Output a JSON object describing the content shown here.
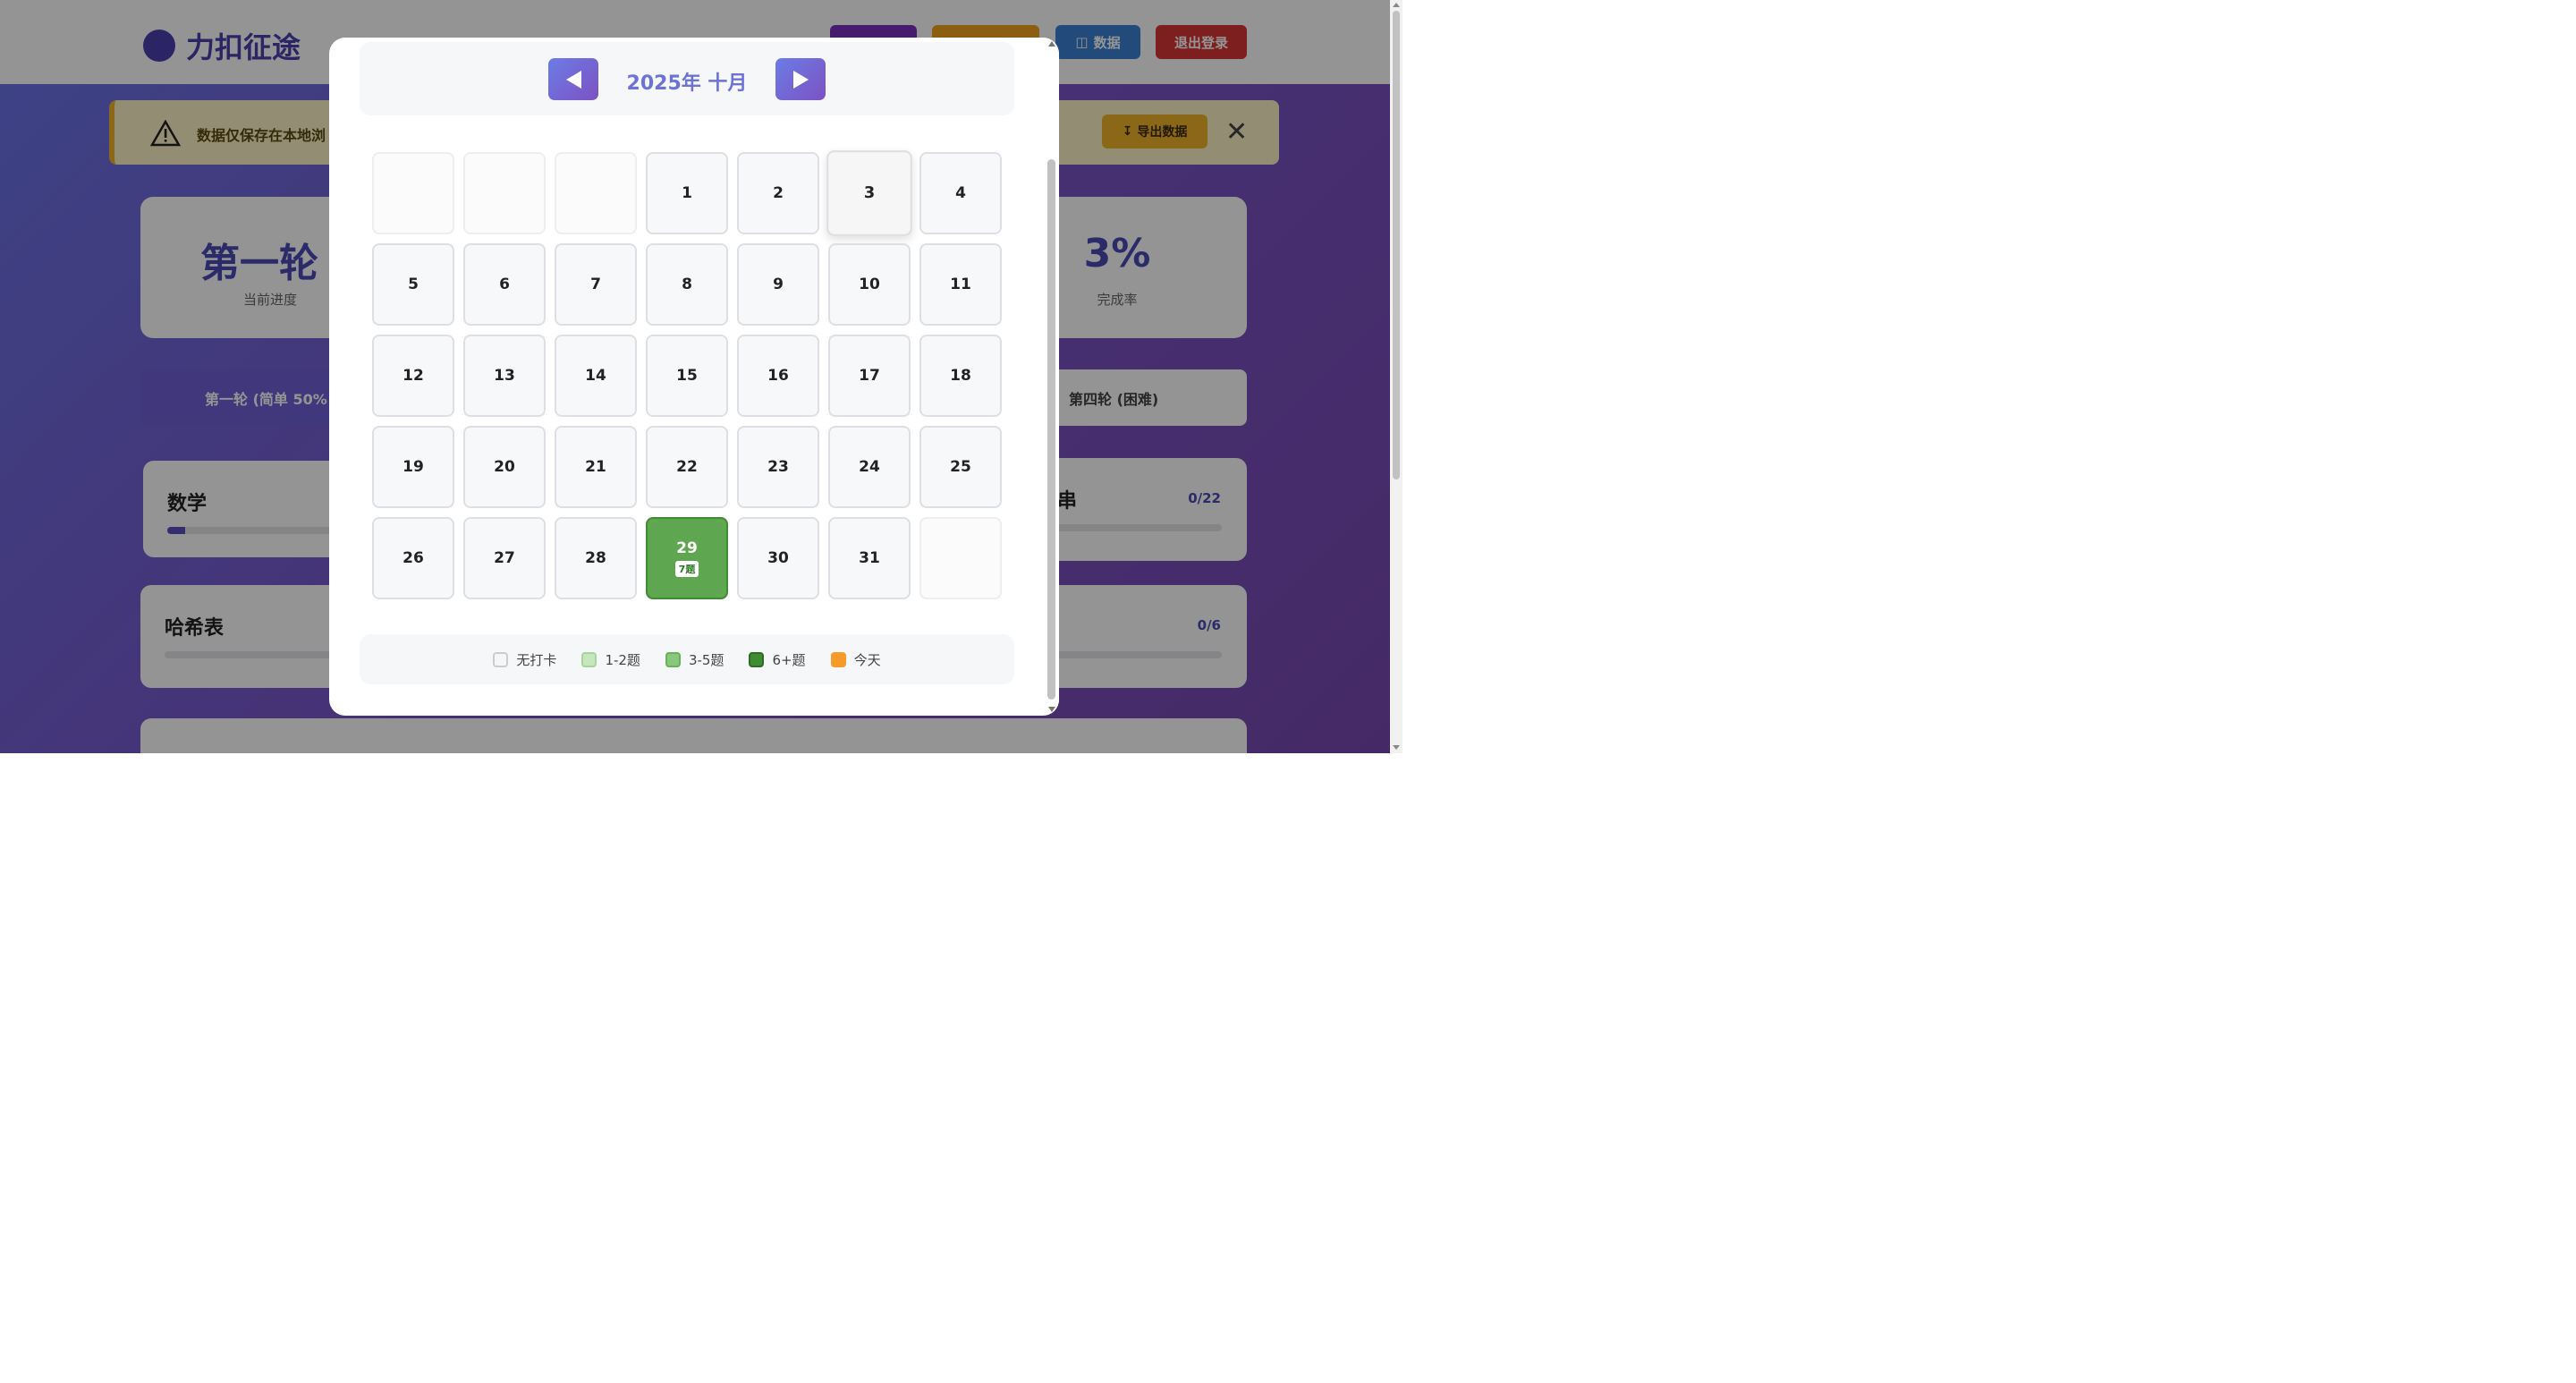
{
  "header": {
    "brand_title": "力扣征途",
    "buttons": [
      "",
      "",
      "数据",
      "退出登录"
    ]
  },
  "warning": {
    "text": "数据仅保存在本地浏",
    "export_label": "导出数据",
    "close_glyph": "✕"
  },
  "stats": [
    {
      "value": "第一轮",
      "label": "当前进度"
    },
    {
      "value": "3%",
      "label": "完成率"
    }
  ],
  "rounds": [
    "第一轮 (简单 50%",
    "第四轮 (困难)"
  ],
  "topics": [
    {
      "title": "数学",
      "count": "",
      "progress": 0.1
    },
    {
      "title": "串",
      "count": "0/22",
      "progress": 0
    },
    {
      "title": "哈希表",
      "count": "",
      "progress": 0
    },
    {
      "title": "",
      "count": "0/6",
      "progress": 0
    }
  ],
  "calendar": {
    "month_label": "2025年 十月",
    "days": [
      {
        "num": "",
        "badge": "",
        "level": "empty"
      },
      {
        "num": "",
        "badge": "",
        "level": "empty"
      },
      {
        "num": "",
        "badge": "",
        "level": "empty"
      },
      {
        "num": "1",
        "badge": "",
        "level": "none"
      },
      {
        "num": "2",
        "badge": "",
        "level": "none"
      },
      {
        "num": "3",
        "badge": "",
        "level": "hover"
      },
      {
        "num": "4",
        "badge": "",
        "level": "none"
      },
      {
        "num": "5",
        "badge": "",
        "level": "none"
      },
      {
        "num": "6",
        "badge": "",
        "level": "none"
      },
      {
        "num": "7",
        "badge": "",
        "level": "none"
      },
      {
        "num": "8",
        "badge": "",
        "level": "none"
      },
      {
        "num": "9",
        "badge": "",
        "level": "none"
      },
      {
        "num": "10",
        "badge": "",
        "level": "none"
      },
      {
        "num": "11",
        "badge": "",
        "level": "none"
      },
      {
        "num": "12",
        "badge": "",
        "level": "none"
      },
      {
        "num": "13",
        "badge": "",
        "level": "none"
      },
      {
        "num": "14",
        "badge": "",
        "level": "none"
      },
      {
        "num": "15",
        "badge": "",
        "level": "none"
      },
      {
        "num": "16",
        "badge": "",
        "level": "none"
      },
      {
        "num": "17",
        "badge": "",
        "level": "none"
      },
      {
        "num": "18",
        "badge": "",
        "level": "none"
      },
      {
        "num": "19",
        "badge": "",
        "level": "none"
      },
      {
        "num": "20",
        "badge": "",
        "level": "none"
      },
      {
        "num": "21",
        "badge": "",
        "level": "none"
      },
      {
        "num": "22",
        "badge": "",
        "level": "none"
      },
      {
        "num": "23",
        "badge": "",
        "level": "none"
      },
      {
        "num": "24",
        "badge": "",
        "level": "none"
      },
      {
        "num": "25",
        "badge": "",
        "level": "none"
      },
      {
        "num": "26",
        "badge": "",
        "level": "none"
      },
      {
        "num": "27",
        "badge": "",
        "level": "none"
      },
      {
        "num": "28",
        "badge": "",
        "level": "none"
      },
      {
        "num": "29",
        "badge": "7题",
        "level": "lvl3"
      },
      {
        "num": "30",
        "badge": "",
        "level": "none"
      },
      {
        "num": "31",
        "badge": "",
        "level": "none"
      },
      {
        "num": "",
        "badge": "",
        "level": "empty"
      }
    ]
  },
  "legend": [
    {
      "label": "无打卡",
      "swatch": "sw-none"
    },
    {
      "label": "1-2题",
      "swatch": "sw-1"
    },
    {
      "label": "3-5题",
      "swatch": "sw-2"
    },
    {
      "label": "6+题",
      "swatch": "sw-3"
    },
    {
      "label": "今天",
      "swatch": "sw-today"
    }
  ],
  "colors": {
    "accent": "#6c72d6",
    "level3": "#5fa651",
    "today": "#f59b2a"
  }
}
